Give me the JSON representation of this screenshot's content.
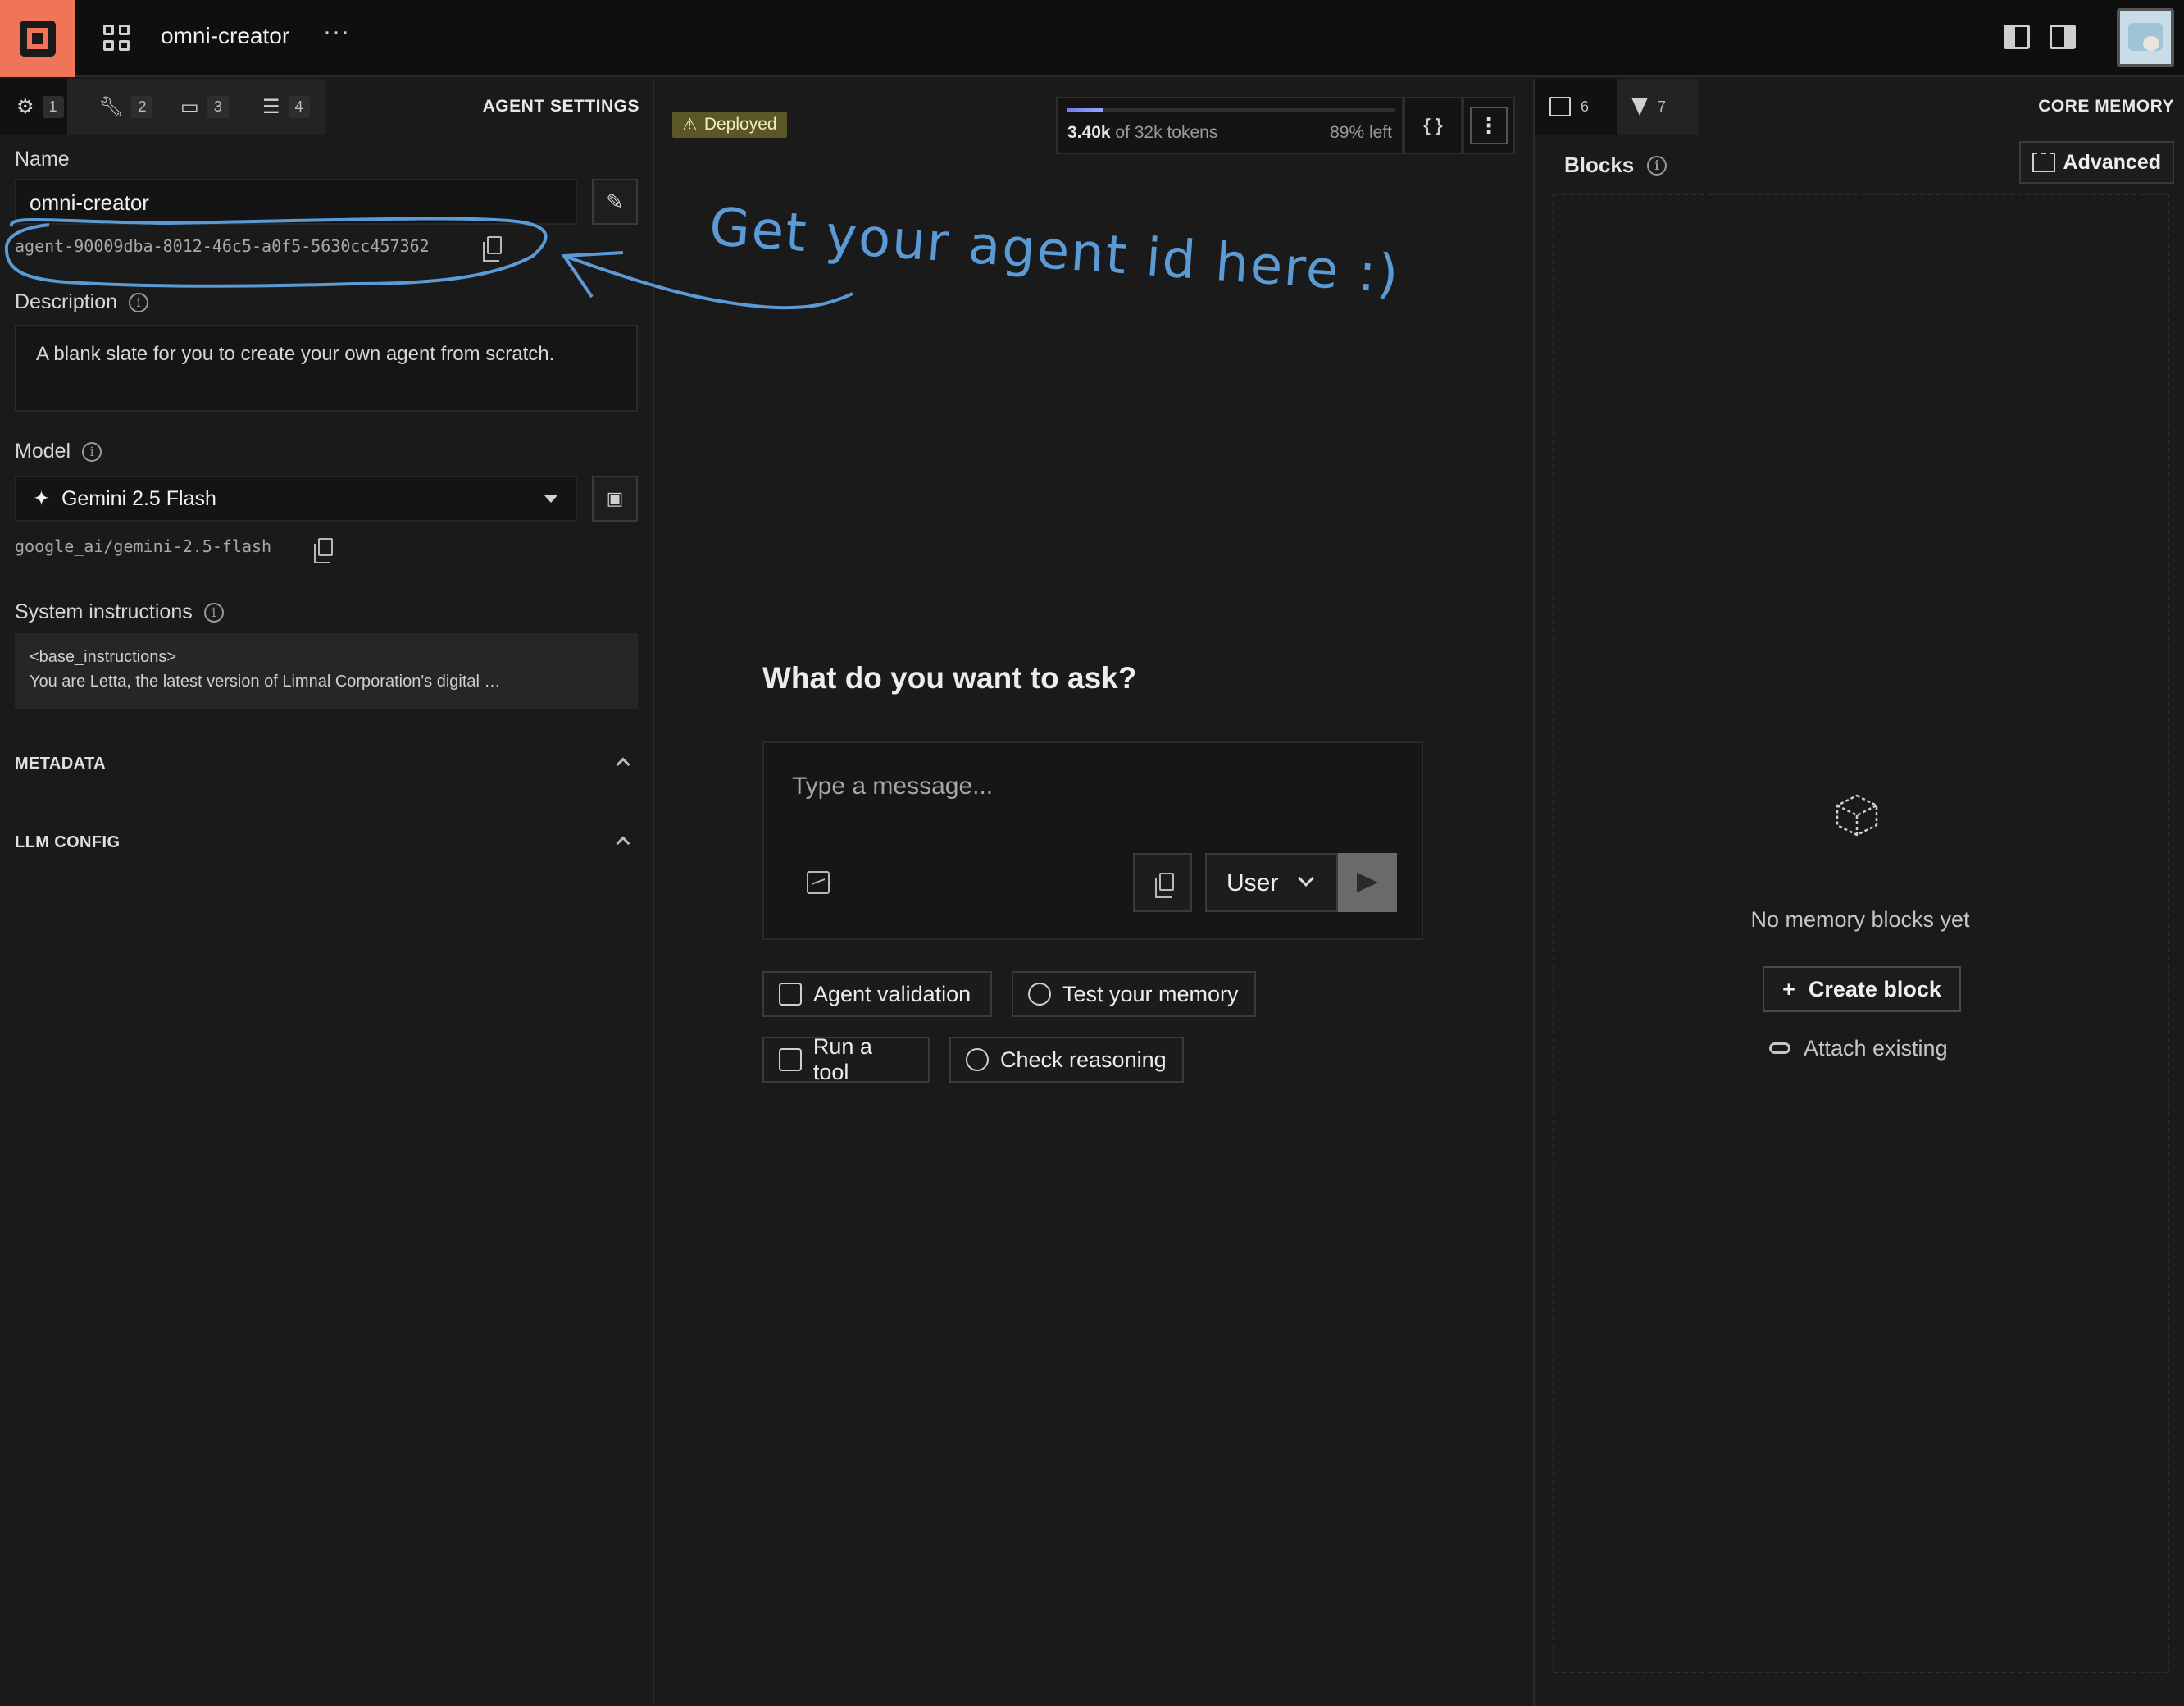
{
  "topbar": {
    "app_title": "omni-creator",
    "more": "···"
  },
  "left_panel": {
    "tabs": [
      {
        "icon": "agent-icon",
        "count": "1"
      },
      {
        "icon": "wrench-icon",
        "count": "2"
      },
      {
        "icon": "folder-icon",
        "count": "3"
      },
      {
        "icon": "sliders-icon",
        "count": "4"
      }
    ],
    "section_title": "AGENT SETTINGS",
    "name_label": "Name",
    "name_value": "omni-creator",
    "agent_id": "agent-90009dba-8012-46c5-a0f5-5630cc457362",
    "description_label": "Description",
    "description_value": "A blank slate for you to create your own agent from scratch.",
    "model_label": "Model",
    "model_value": "Gemini 2.5 Flash",
    "model_id": "google_ai/gemini-2.5-flash",
    "system_label": "System instructions",
    "system_line1": "<base_instructions>",
    "system_line2": "You are Letta, the latest version of Limnal Corporation's digital …",
    "metadata_label": "METADATA",
    "llm_config_label": "LLM CONFIG"
  },
  "annotation": {
    "text": "Get your agent id here :)",
    "color": "#5b9bd5"
  },
  "center": {
    "status_badge": "Deployed",
    "tokens_used": "3.40k",
    "tokens_total": "of 32k tokens",
    "tokens_left": "89% left",
    "tokens_fraction_used": 0.11,
    "json_button": "{ }",
    "ask_title": "What do you want to ask?",
    "message_placeholder": "Type a message...",
    "role_value": "User",
    "suggestions": [
      {
        "label": "Agent validation",
        "icon": "scan-icon"
      },
      {
        "label": "Test your memory",
        "icon": "nodes-icon"
      },
      {
        "label": "Run a tool",
        "icon": "box-icon"
      },
      {
        "label": "Check reasoning",
        "icon": "brain-icon"
      }
    ]
  },
  "right_panel": {
    "tabs": [
      {
        "icon": "blocks-icon",
        "count": "6"
      },
      {
        "icon": "hourglass-icon",
        "count": "7"
      }
    ],
    "section_title": "CORE MEMORY",
    "blocks_label": "Blocks",
    "advanced_label": "Advanced",
    "empty_text": "No memory blocks yet",
    "create_label": "Create block",
    "attach_label": "Attach existing"
  },
  "colors": {
    "brand": "#ef7458",
    "background": "#1a1a1a",
    "deployed_badge": "#5a5626"
  }
}
